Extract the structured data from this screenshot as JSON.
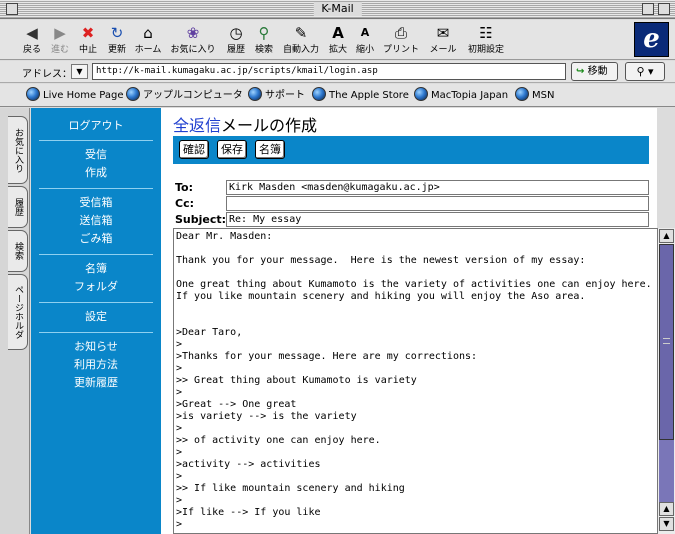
{
  "window": {
    "title": "K-Mail"
  },
  "toolbar": {
    "buttons": [
      {
        "label": "戻る",
        "icon": "back-arrow-icon",
        "glyph": "◀"
      },
      {
        "label": "進む",
        "icon": "forward-arrow-icon",
        "glyph": "▶"
      },
      {
        "label": "中止",
        "icon": "stop-icon",
        "glyph": "✖"
      },
      {
        "label": "更新",
        "icon": "refresh-icon",
        "glyph": "↻"
      },
      {
        "label": "ホーム",
        "icon": "home-icon",
        "glyph": "⌂"
      },
      {
        "label": "お気に入り",
        "icon": "favorites-icon",
        "glyph": "❀"
      },
      {
        "label": "履歴",
        "icon": "history-icon",
        "glyph": "◷"
      },
      {
        "label": "検索",
        "icon": "search-icon",
        "glyph": "⚲"
      },
      {
        "label": "自動入力",
        "icon": "autofill-icon",
        "glyph": "✎"
      },
      {
        "label": "拡大",
        "icon": "text-larger-icon",
        "glyph": "A"
      },
      {
        "label": "縮小",
        "icon": "text-smaller-icon",
        "glyph": "a"
      },
      {
        "label": "プリント",
        "icon": "print-icon",
        "glyph": "⎙"
      },
      {
        "label": "メール",
        "icon": "mail-icon",
        "glyph": "✉"
      },
      {
        "label": "初期設定",
        "icon": "preferences-icon",
        "glyph": "☷"
      }
    ]
  },
  "address": {
    "label": "アドレス：",
    "url": "http://k-mail.kumagaku.ac.jp/scripts/kmail/login.asp",
    "go_label": "移動"
  },
  "favorites": [
    "Live Home Page",
    "アップルコンピュータ",
    "サポート",
    "The Apple Store",
    "MacTopia Japan",
    "MSN"
  ],
  "sidetabs": [
    "お気に入り",
    "履歴",
    "検索",
    "ページホルダ"
  ],
  "nav": {
    "logout": "ログアウト",
    "inbox": "受信",
    "compose": "作成",
    "inbox_box": "受信箱",
    "sent_box": "送信箱",
    "trash_box": "ごみ箱",
    "address_book": "名簿",
    "folder": "フォルダ",
    "settings": "設定",
    "notice": "お知らせ",
    "howto": "利用方法",
    "history": "更新履歴"
  },
  "compose": {
    "heading_link": "全返信",
    "heading_rest": "メールの作成",
    "buttons": {
      "confirm": "確認",
      "save": "保存",
      "address_book": "名簿"
    },
    "to_label": "To:",
    "to_value": "Kirk Masden <masden@kumagaku.ac.jp>",
    "cc_label": "Cc:",
    "cc_value": "",
    "subject_label": "Subject:",
    "subject_value": "Re: My essay",
    "body": "Dear Mr. Masden:\n\nThank you for your message.  Here is the newest version of my essay:\n\nOne great thing about Kumamoto is the variety of activities one can enjoy here.\nIf you like mountain scenery and hiking you will enjoy the Aso area.\n\n\n>Dear Taro,\n>\n>Thanks for your message. Here are my corrections:\n>\n>> Great thing about Kumamoto is variety\n>\n>Great --> One great\n>is variety --> is the variety\n>\n>> of activity one can enjoy here.\n>\n>activity --> activities\n>\n>> If like mountain scenery and hiking\n>\n>If like --> If you like\n>"
  }
}
